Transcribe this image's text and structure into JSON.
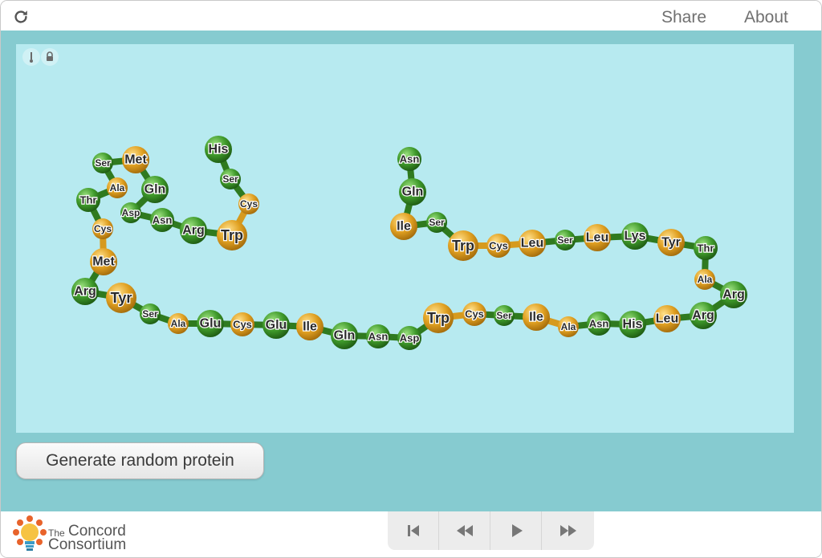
{
  "header": {
    "share_label": "Share",
    "about_label": "About"
  },
  "controls": {
    "generate_label": "Generate random protein"
  },
  "footer": {
    "logo_the": "The",
    "logo_line1": "Concord",
    "logo_line2": "Consortium"
  },
  "protein": {
    "colors": {
      "hydrophobic": "#e0a021",
      "hydrophilic": "#3f9a2b",
      "bond_dark": "#2f7a1f",
      "bond_light": "#d69a1e"
    },
    "chain": [
      {
        "name": "His",
        "type": "hydrophilic",
        "size": "l"
      },
      {
        "name": "Ser",
        "type": "hydrophilic",
        "size": "s"
      },
      {
        "name": "Cys",
        "type": "hydrophobic",
        "size": "s"
      },
      {
        "name": "Trp",
        "type": "hydrophobic",
        "size": "xl"
      },
      {
        "name": "Arg",
        "type": "hydrophilic",
        "size": "l"
      },
      {
        "name": "Asn",
        "type": "hydrophilic",
        "size": "m"
      },
      {
        "name": "Asp",
        "type": "hydrophilic",
        "size": "s"
      },
      {
        "name": "Gln",
        "type": "hydrophilic",
        "size": "l"
      },
      {
        "name": "Met",
        "type": "hydrophobic",
        "size": "l"
      },
      {
        "name": "Ser",
        "type": "hydrophilic",
        "size": "s"
      },
      {
        "name": "Ala",
        "type": "hydrophobic",
        "size": "s"
      },
      {
        "name": "Thr",
        "type": "hydrophilic",
        "size": "m"
      },
      {
        "name": "Cys",
        "type": "hydrophobic",
        "size": "s"
      },
      {
        "name": "Met",
        "type": "hydrophobic",
        "size": "l"
      },
      {
        "name": "Arg",
        "type": "hydrophilic",
        "size": "l"
      },
      {
        "name": "Tyr",
        "type": "hydrophobic",
        "size": "xl"
      },
      {
        "name": "Ser",
        "type": "hydrophilic",
        "size": "s"
      },
      {
        "name": "Ala",
        "type": "hydrophobic",
        "size": "s"
      },
      {
        "name": "Glu",
        "type": "hydrophilic",
        "size": "l"
      },
      {
        "name": "Cys",
        "type": "hydrophobic",
        "size": "m"
      },
      {
        "name": "Glu",
        "type": "hydrophilic",
        "size": "l"
      },
      {
        "name": "Ile",
        "type": "hydrophobic",
        "size": "l"
      },
      {
        "name": "Gln",
        "type": "hydrophilic",
        "size": "l"
      },
      {
        "name": "Asn",
        "type": "hydrophilic",
        "size": "m"
      },
      {
        "name": "Asp",
        "type": "hydrophilic",
        "size": "m"
      },
      {
        "name": "Trp",
        "type": "hydrophobic",
        "size": "xl"
      },
      {
        "name": "Cys",
        "type": "hydrophobic",
        "size": "m"
      },
      {
        "name": "Ser",
        "type": "hydrophilic",
        "size": "s"
      },
      {
        "name": "Ile",
        "type": "hydrophobic",
        "size": "l"
      },
      {
        "name": "Ala",
        "type": "hydrophobic",
        "size": "s"
      },
      {
        "name": "Asn",
        "type": "hydrophilic",
        "size": "m"
      },
      {
        "name": "His",
        "type": "hydrophilic",
        "size": "l"
      },
      {
        "name": "Leu",
        "type": "hydrophobic",
        "size": "l"
      },
      {
        "name": "Arg",
        "type": "hydrophilic",
        "size": "l"
      },
      {
        "name": "Arg",
        "type": "hydrophilic",
        "size": "l"
      },
      {
        "name": "Ala",
        "type": "hydrophobic",
        "size": "s"
      },
      {
        "name": "Thr",
        "type": "hydrophilic",
        "size": "m"
      },
      {
        "name": "Tyr",
        "type": "hydrophobic",
        "size": "l"
      },
      {
        "name": "Lys",
        "type": "hydrophilic",
        "size": "l"
      },
      {
        "name": "Leu",
        "type": "hydrophobic",
        "size": "l"
      },
      {
        "name": "Ser",
        "type": "hydrophilic",
        "size": "s"
      },
      {
        "name": "Leu",
        "type": "hydrophobic",
        "size": "l"
      },
      {
        "name": "Cys",
        "type": "hydrophobic",
        "size": "m"
      },
      {
        "name": "Trp",
        "type": "hydrophobic",
        "size": "xl"
      },
      {
        "name": "Ser",
        "type": "hydrophilic",
        "size": "s"
      },
      {
        "name": "Ile",
        "type": "hydrophobic",
        "size": "l"
      },
      {
        "name": "Gln",
        "type": "hydrophilic",
        "size": "l"
      },
      {
        "name": "Asn",
        "type": "hydrophilic",
        "size": "m"
      }
    ]
  },
  "icons": {
    "reload": "reload-icon",
    "thermometer": "thermometer-icon",
    "lock": "lock-icon",
    "first": "skip-first-icon",
    "rewind": "rewind-icon",
    "play": "play-icon",
    "forward": "fast-forward-icon"
  }
}
